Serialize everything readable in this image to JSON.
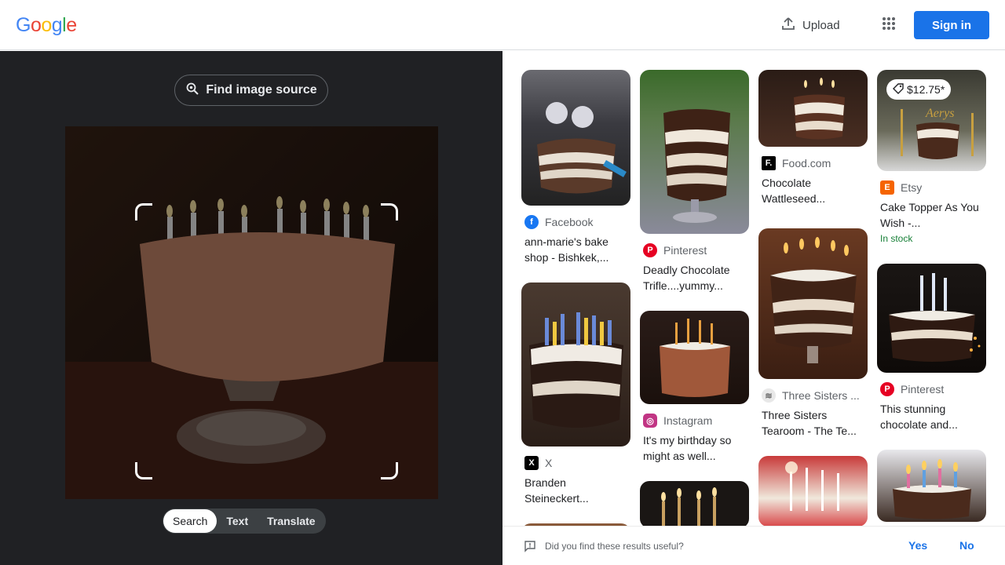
{
  "header": {
    "logo": [
      "G",
      "o",
      "o",
      "g",
      "l",
      "e"
    ],
    "logo_colors": [
      "#4285F4",
      "#EA4335",
      "#FBBC05",
      "#4285F4",
      "#34A853",
      "#EA4335"
    ],
    "upload_label": "Upload",
    "signin_label": "Sign in"
  },
  "lens": {
    "find_source_label": "Find image source",
    "tabs": [
      {
        "label": "Search",
        "active": true
      },
      {
        "label": "Text",
        "active": false
      },
      {
        "label": "Translate",
        "active": false
      }
    ]
  },
  "results": [
    {
      "source": "Facebook",
      "title": "ann-marie's bake shop - Bishkek,...",
      "icon": "facebook-icon",
      "icon_color": "#1877F2"
    },
    {
      "source": "X",
      "title": "Branden Steineckert...",
      "icon": "x-icon",
      "icon_color": "#000000"
    },
    {
      "source": "Pinterest",
      "title": "Deadly Chocolate Trifle....yummy...",
      "icon": "pinterest-icon",
      "icon_color": "#E60023"
    },
    {
      "source": "Instagram",
      "title": "It's my birthday so might as well...",
      "icon": "instagram-icon",
      "icon_color": "#C13584"
    },
    {
      "source": "Food.com",
      "title": "Chocolate Wattleseed...",
      "icon": "food-com-icon",
      "icon_color": "#000000"
    },
    {
      "source": "Three Sisters ...",
      "title": "Three Sisters Tearoom - The Te...",
      "icon": "three-sisters-icon",
      "icon_color": "#9e9e9e"
    },
    {
      "source": "Etsy",
      "title": "Cake Topper As You Wish -...",
      "icon": "etsy-icon",
      "icon_color": "#F56400",
      "price": "$12.75*",
      "stock": "In stock"
    },
    {
      "source": "Pinterest",
      "title": "This stunning chocolate and...",
      "icon": "pinterest-icon",
      "icon_color": "#E60023"
    }
  ],
  "feedback": {
    "question": "Did you find these results useful?",
    "yes": "Yes",
    "no": "No"
  }
}
